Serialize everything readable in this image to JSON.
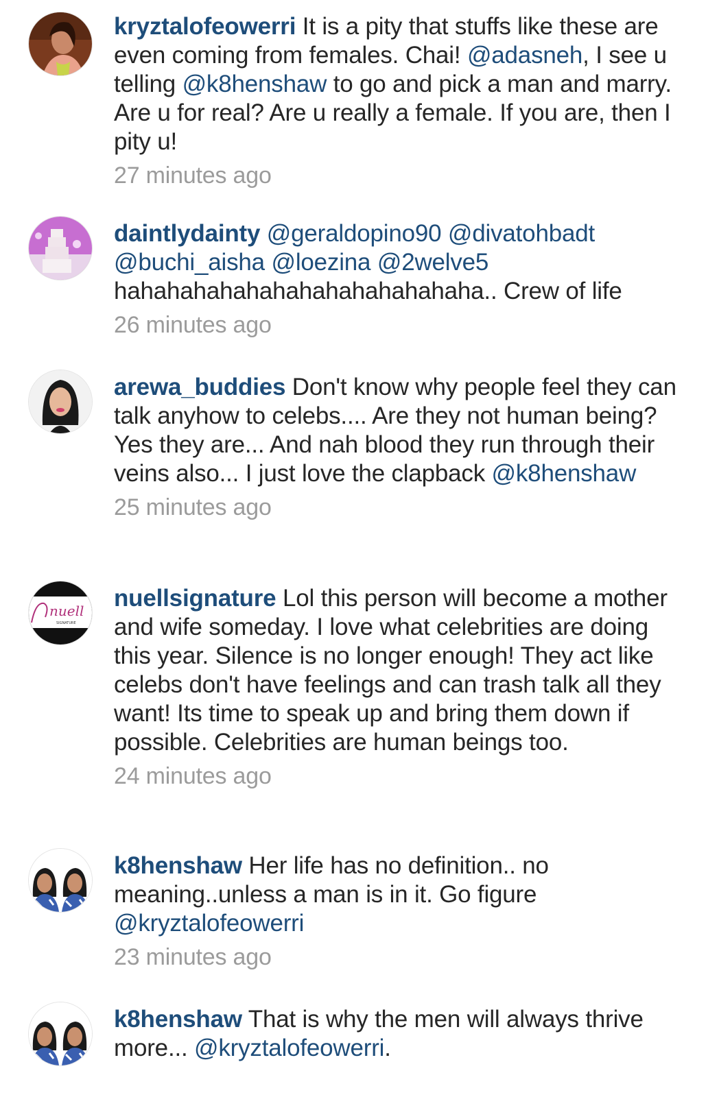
{
  "comments": [
    {
      "username": "kryztalofeowerri",
      "text": [
        {
          "type": "text",
          "value": " It is a pity that stuffs like these are even coming from females.  Chai! "
        },
        {
          "type": "mention",
          "value": "@adasneh"
        },
        {
          "type": "text",
          "value": ", I see u telling "
        },
        {
          "type": "mention",
          "value": "@k8henshaw"
        },
        {
          "type": "text",
          "value": " to go and pick a man and marry. Are u for real? Are u really a female. If you are, then I pity u!"
        }
      ],
      "time": "27 minutes ago",
      "avatar_icon": "woman-portrait-avatar"
    },
    {
      "username": "daintlydainty",
      "text": [
        {
          "type": "text",
          "value": " "
        },
        {
          "type": "mention",
          "value": "@geraldopino90"
        },
        {
          "type": "text",
          "value": " "
        },
        {
          "type": "mention",
          "value": "@divatohbadt"
        },
        {
          "type": "text",
          "value": " "
        },
        {
          "type": "mention",
          "value": "@buchi_aisha"
        },
        {
          "type": "text",
          "value": " "
        },
        {
          "type": "mention",
          "value": "@loezina"
        },
        {
          "type": "text",
          "value": " "
        },
        {
          "type": "mention",
          "value": "@2welve5"
        },
        {
          "type": "text",
          "value": " hahahahahahahahahahahahahaha.. Crew of life"
        }
      ],
      "time": "26 minutes ago",
      "avatar_icon": "wedding-cake-avatar"
    },
    {
      "username": "arewa_buddies",
      "text": [
        {
          "type": "text",
          "value": " Don't know why people feel they can talk anyhow to celebs.... Are they not human being? Yes they are... And nah blood they run through their veins also... I just love the clapback "
        },
        {
          "type": "mention",
          "value": "@k8henshaw"
        }
      ],
      "time": "25 minutes ago",
      "avatar_icon": "woman-portrait-avatar"
    },
    {
      "username": "nuellsignature",
      "text": [
        {
          "type": "text",
          "value": " Lol this person will become a mother and wife someday. I love what celebrities are doing this year. Silence is no longer enough! They act like celebs don't have feelings and can trash talk all they want! Its time to speak up and bring them down if possible. Celebrities are human beings too."
        }
      ],
      "time": "24 minutes ago",
      "avatar_icon": "nuell-signature-logo-avatar",
      "avatar_logo_text": "nuell",
      "avatar_logo_subtext": "SIGNATURE"
    },
    {
      "username": "k8henshaw",
      "text": [
        {
          "type": "text",
          "value": " Her life has no definition.. no meaning..unless a man is in it. Go figure "
        },
        {
          "type": "mention",
          "value": "@kryztalofeowerri"
        }
      ],
      "time": "23 minutes ago",
      "avatar_icon": "twin-women-avatar"
    },
    {
      "username": "k8henshaw",
      "text": [
        {
          "type": "text",
          "value": " That is why the men will always thrive more... "
        },
        {
          "type": "mention",
          "value": "@kryztalofeowerri"
        },
        {
          "type": "text",
          "value": "."
        }
      ],
      "time": "",
      "avatar_icon": "twin-women-avatar"
    }
  ],
  "colors": {
    "username": "#1e4d7a",
    "mention": "#1e4d7a",
    "text": "#262626",
    "time": "#9b9b9b",
    "background": "#ffffff"
  }
}
